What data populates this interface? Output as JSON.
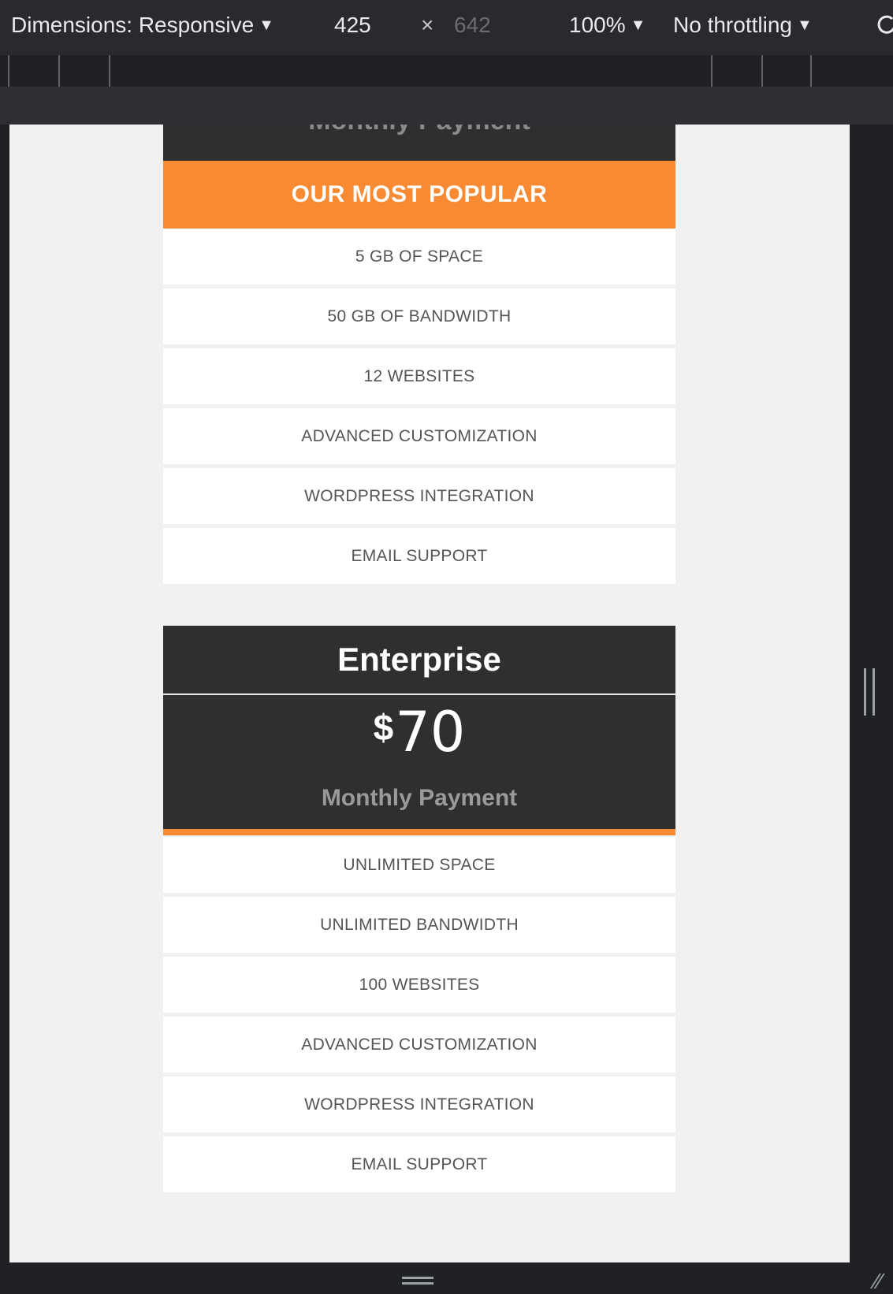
{
  "devtools": {
    "dimensions_label": "Dimensions: Responsive",
    "width": "425",
    "times": "×",
    "height": "642",
    "zoom": "100%",
    "throttling": "No throttling"
  },
  "cards": {
    "card1": {
      "header_partial": "Monthly Payment",
      "ribbon": "OUR MOST POPULAR",
      "features": [
        "5 GB OF SPACE",
        "50 GB OF BANDWIDTH",
        "12 WEBSITES",
        "ADVANCED CUSTOMIZATION",
        "WORDPRESS INTEGRATION",
        "EMAIL SUPPORT"
      ]
    },
    "card2": {
      "name": "Enterprise",
      "currency": "$",
      "amount": "70",
      "period": "Monthly Payment",
      "features": [
        "UNLIMITED SPACE",
        "UNLIMITED BANDWIDTH",
        "100 WEBSITES",
        "ADVANCED CUSTOMIZATION",
        "WORDPRESS INTEGRATION",
        "EMAIL SUPPORT"
      ]
    }
  },
  "colors": {
    "accent_orange": "#f78a32",
    "card_dark": "#2f2f2f",
    "devtools_bg": "#292a2d"
  }
}
